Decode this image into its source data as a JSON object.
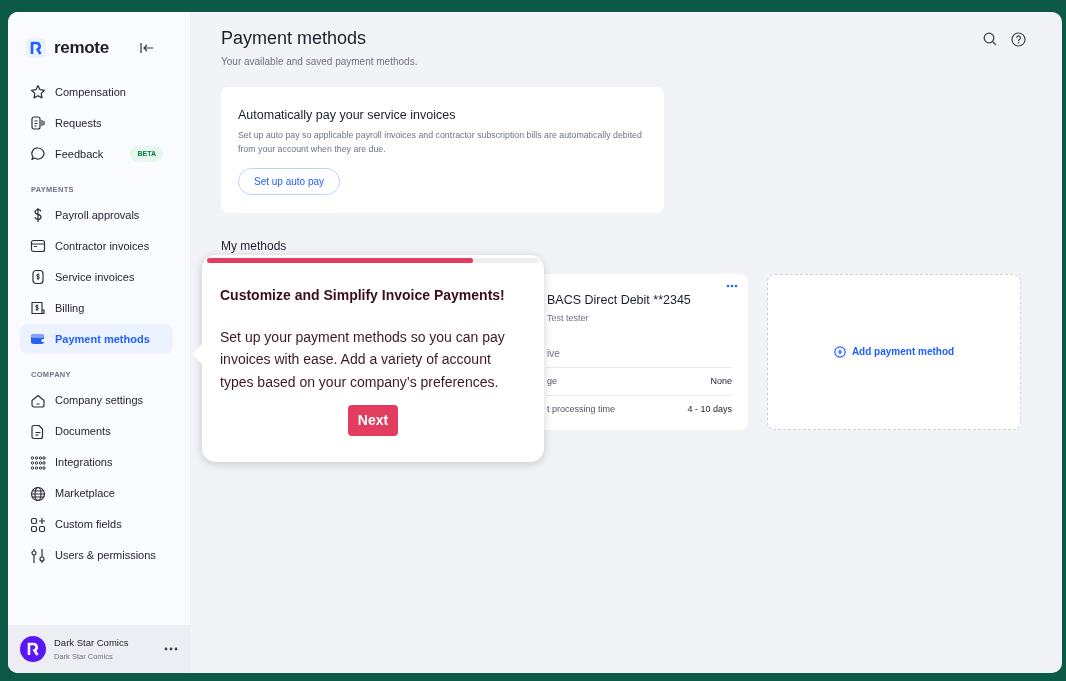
{
  "brand": {
    "name": "remote"
  },
  "sidebar": {
    "sections": [
      {
        "items": [
          {
            "label": "Compensation",
            "selected": false
          },
          {
            "label": "Requests",
            "selected": false
          },
          {
            "label": "Feedback",
            "selected": false,
            "badge": "BETA"
          }
        ]
      },
      {
        "heading": "PAYMENTS",
        "items": [
          {
            "label": "Payroll approvals",
            "selected": false
          },
          {
            "label": "Contractor invoices",
            "selected": false
          },
          {
            "label": "Service invoices",
            "selected": false
          },
          {
            "label": "Billing",
            "selected": false
          },
          {
            "label": "Payment methods",
            "selected": true
          }
        ]
      },
      {
        "heading": "COMPANY",
        "items": [
          {
            "label": "Company settings",
            "selected": false
          },
          {
            "label": "Documents",
            "selected": false
          },
          {
            "label": "Integrations",
            "selected": false
          },
          {
            "label": "Marketplace",
            "selected": false
          },
          {
            "label": "Custom fields",
            "selected": false
          },
          {
            "label": "Users & permissions",
            "selected": false
          }
        ]
      }
    ]
  },
  "account": {
    "name": "Dark Star Comics",
    "subtitle": "Dark Star Comics"
  },
  "header": {
    "title": "Payment methods",
    "subtitle": "Your available and saved payment methods."
  },
  "autopay": {
    "title": "Automatically pay your service invoices",
    "text": "Set up auto pay so applicable payroll invoices and contractor subscription bills are automatically debited from your account when they are due.",
    "button": "Set up auto pay"
  },
  "methods": {
    "heading": "My methods",
    "cards": [
      {
        "title": "BACS Direct Debit **2345",
        "holder": "Test tester",
        "status": "ive",
        "rows": [
          {
            "label": "ge",
            "value": "None"
          },
          {
            "label": "t processing time",
            "value": "4 - 10 days"
          }
        ]
      }
    ],
    "add_label": "Add payment method"
  },
  "tour": {
    "level": 0.8,
    "title": "Customize and Simplify Invoice Payments!",
    "text": "Set up your payment methods so you can pay invoices with ease. Add a variety of account types based on your company’s preferences.",
    "button": "Next"
  }
}
